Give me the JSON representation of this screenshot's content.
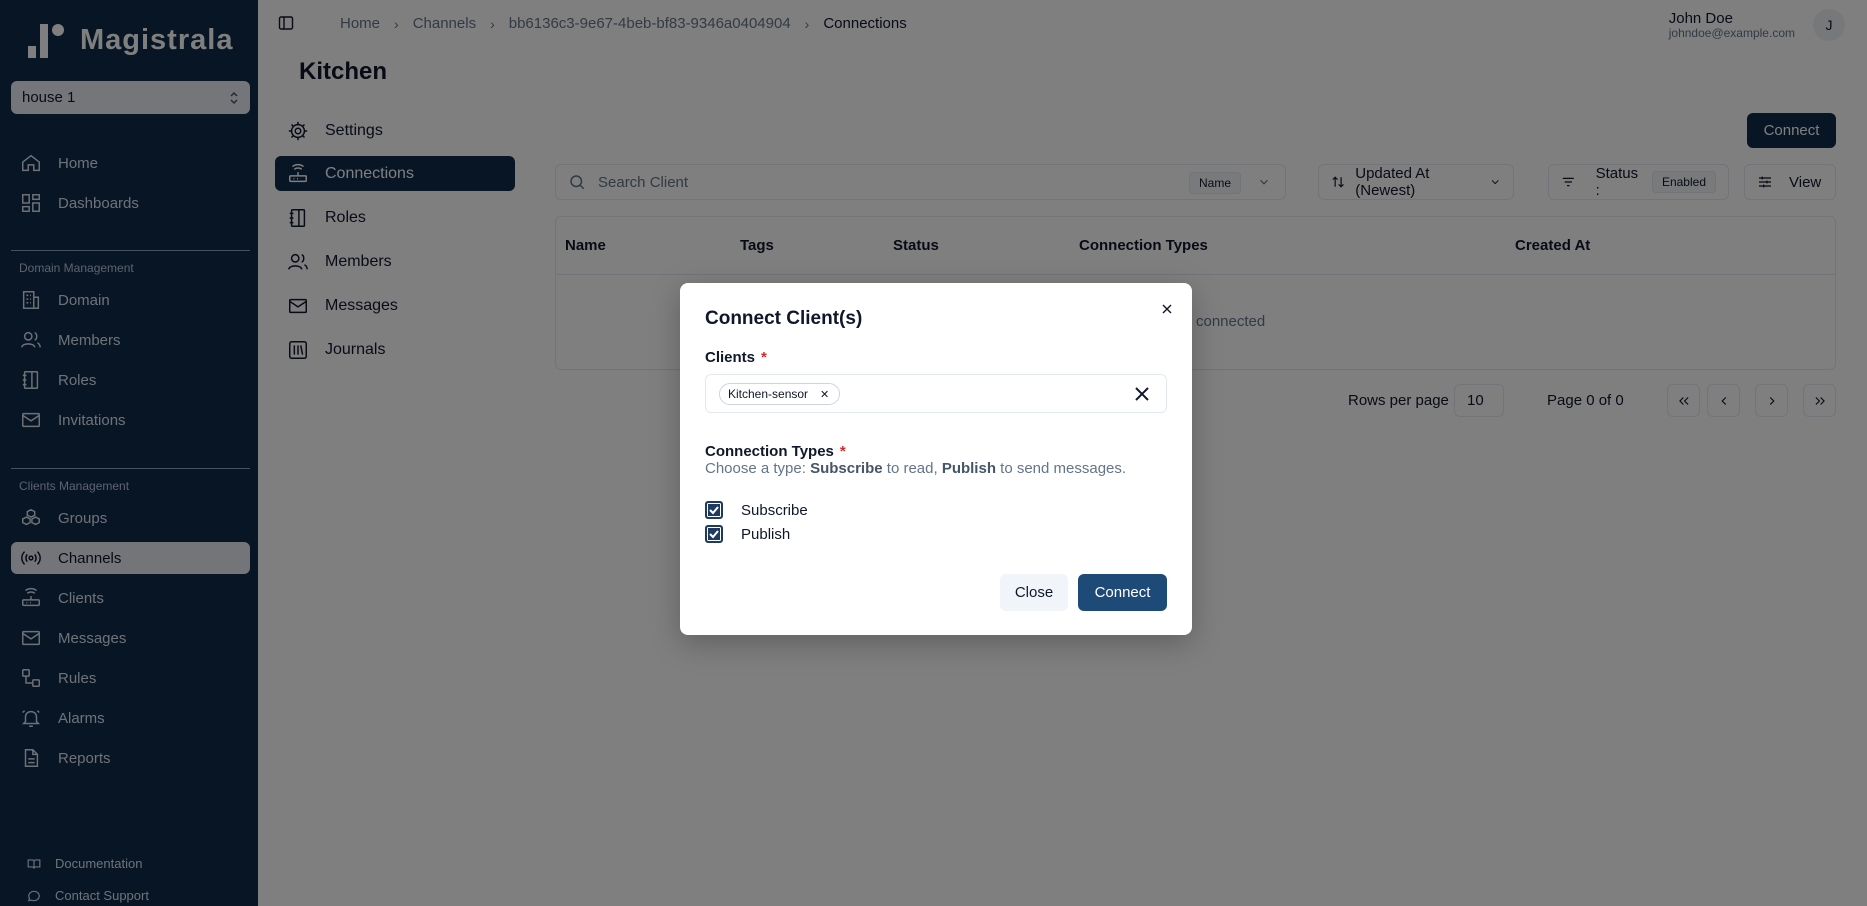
{
  "brand": {
    "name": "Magistrala"
  },
  "workspace": {
    "selected": "house 1"
  },
  "sidebar": {
    "top_items": [
      {
        "label": "Home",
        "icon": "home-icon"
      },
      {
        "label": "Dashboards",
        "icon": "dashboard-icon"
      }
    ],
    "domain_section": {
      "title": "Domain Management",
      "items": [
        {
          "label": "Domain",
          "icon": "building-icon"
        },
        {
          "label": "Members",
          "icon": "users-icon"
        },
        {
          "label": "Roles",
          "icon": "notebook-icon"
        },
        {
          "label": "Invitations",
          "icon": "mail-icon"
        }
      ]
    },
    "clients_section": {
      "title": "Clients Management",
      "items": [
        {
          "label": "Groups",
          "icon": "groups-icon"
        },
        {
          "label": "Channels",
          "icon": "radio-icon",
          "active": true
        },
        {
          "label": "Clients",
          "icon": "router-icon"
        },
        {
          "label": "Messages",
          "icon": "mail-icon"
        },
        {
          "label": "Rules",
          "icon": "workflow-icon"
        },
        {
          "label": "Alarms",
          "icon": "bell-icon"
        },
        {
          "label": "Reports",
          "icon": "file-icon"
        }
      ]
    },
    "footer": [
      {
        "label": "Documentation",
        "icon": "book-icon"
      },
      {
        "label": "Contact Support",
        "icon": "chat-icon"
      }
    ]
  },
  "breadcrumb": [
    "Home",
    "Channels",
    "bb6136c3-9e67-4beb-bf83-9346a0404904",
    "Connections"
  ],
  "user": {
    "name": "John Doe",
    "email": "johndoe@example.com",
    "initial": "J"
  },
  "page": {
    "title": "Kitchen",
    "subnav": [
      {
        "label": "Settings",
        "icon": "gear-icon"
      },
      {
        "label": "Connections",
        "icon": "router-icon",
        "active": true
      },
      {
        "label": "Roles",
        "icon": "notebook-icon"
      },
      {
        "label": "Members",
        "icon": "users-icon"
      },
      {
        "label": "Messages",
        "icon": "mail-icon"
      },
      {
        "label": "Journals",
        "icon": "library-icon"
      }
    ],
    "connect_button": "Connect",
    "search": {
      "placeholder": "Search Client",
      "field": "Name"
    },
    "sort": {
      "label": "Updated At (Newest)"
    },
    "status_filter": {
      "label": "Status :",
      "value": "Enabled"
    },
    "view_button": "View",
    "table": {
      "columns": [
        "Name",
        "Tags",
        "Status",
        "Connection Types",
        "Created At"
      ],
      "empty_text": "connected"
    },
    "pagination": {
      "rows_label": "Rows per page",
      "rows_value": "10",
      "page_text": "Page 0 of 0"
    }
  },
  "modal": {
    "title": "Connect Client(s)",
    "clients_label": "Clients",
    "selected_clients": [
      "Kitchen-sensor"
    ],
    "types_label": "Connection Types",
    "hint_prefix": "Choose a type: ",
    "hint_subscribe": "Subscribe",
    "hint_mid": " to read, ",
    "hint_publish": "Publish",
    "hint_suffix": " to send messages.",
    "options": [
      {
        "label": "Subscribe",
        "checked": true
      },
      {
        "label": "Publish",
        "checked": true
      }
    ],
    "close_label": "Close",
    "connect_label": "Connect"
  },
  "colors": {
    "sidebar_bg": "#0f2a4a",
    "primary": "#1e4a78",
    "required": "#dc2626"
  }
}
